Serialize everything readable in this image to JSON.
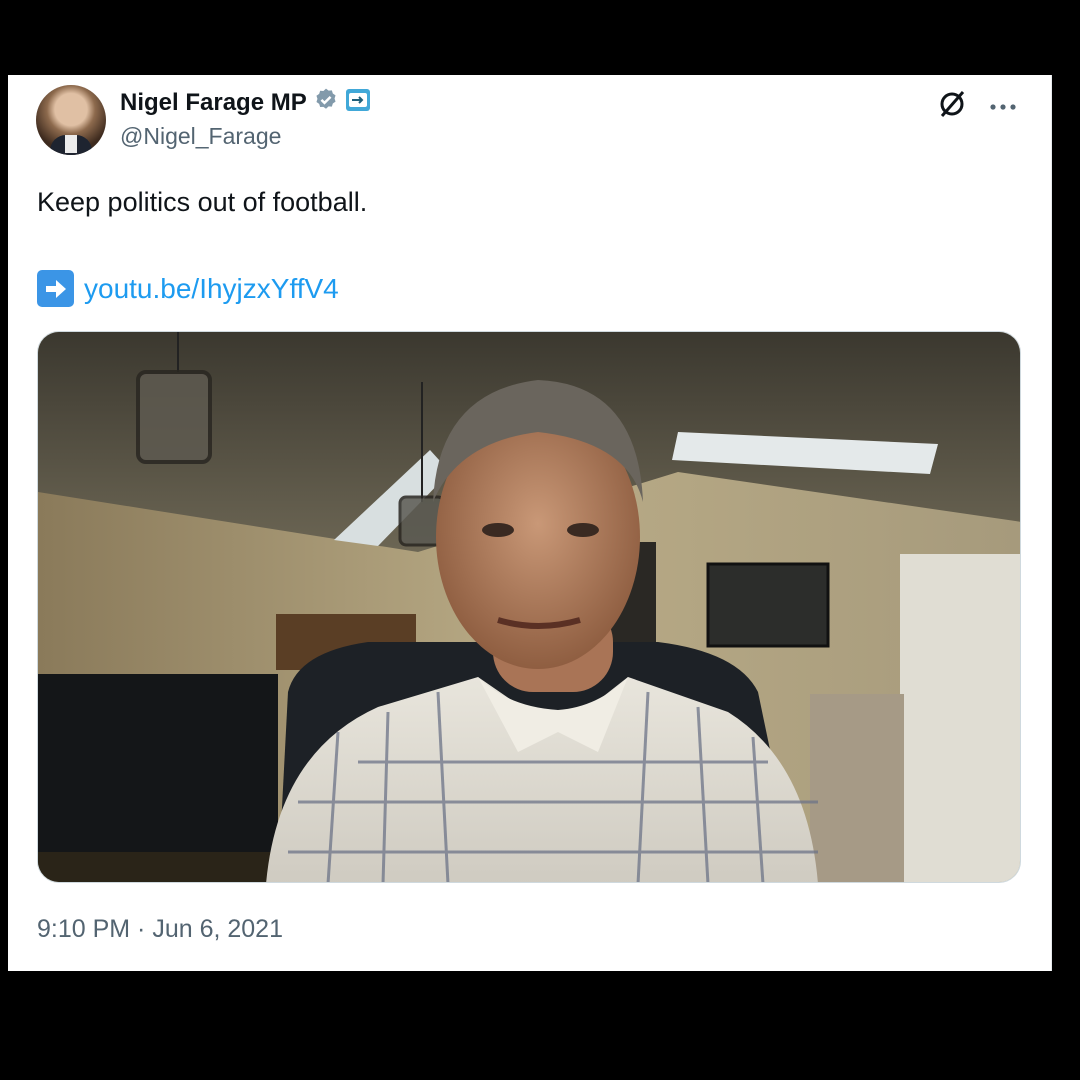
{
  "tweet": {
    "author_name": "Nigel Farage MP",
    "handle": "@Nigel_Farage",
    "text": "Keep politics out of football.",
    "link_text": "youtu.be/IhyjzxYffV4",
    "timestamp": "9:10 PM · Jun 6, 2021"
  },
  "icons": {
    "verified": "verified-badge-icon",
    "affiliate": "affiliation-badge-icon",
    "grok": "grok-icon",
    "more": "more-options-icon",
    "link_arrow": "right-arrow-emoji-icon"
  },
  "colors": {
    "verified_badge": "#829aab",
    "link": "#1d9bf0",
    "secondary_text": "#536471",
    "arrow_box": "#3b95e6"
  }
}
